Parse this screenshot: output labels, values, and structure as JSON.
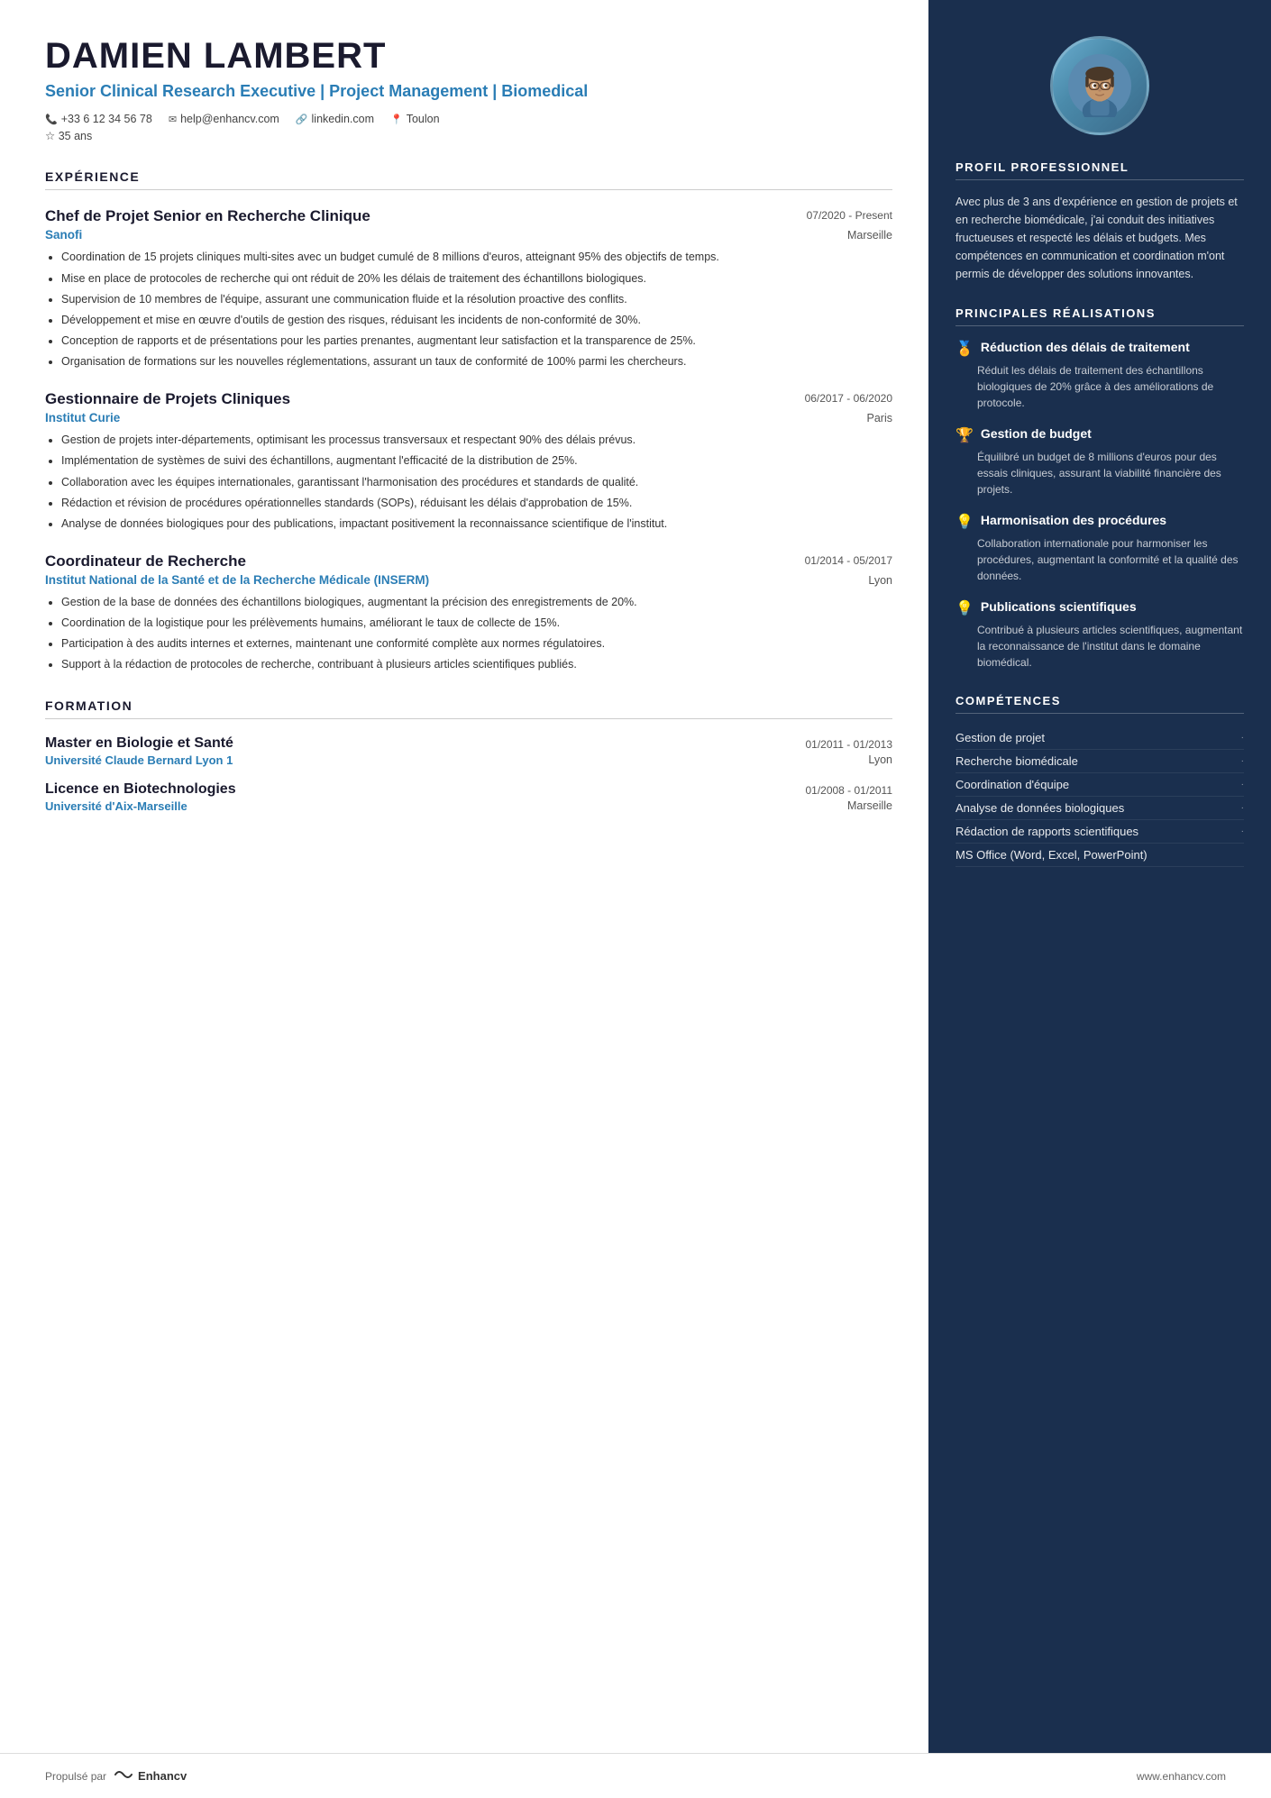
{
  "header": {
    "name": "DAMIEN LAMBERT",
    "title": "Senior Clinical Research Executive | Project Management | Biomedical",
    "phone": "+33 6 12 34 56 78",
    "email": "help@enhancv.com",
    "linkedin": "linkedin.com",
    "city": "Toulon",
    "age": "35 ans"
  },
  "sections": {
    "experience_title": "EXPÉRIENCE",
    "formation_title": "FORMATION"
  },
  "experiences": [
    {
      "job_title": "Chef de Projet Senior en Recherche Clinique",
      "dates": "07/2020 - Present",
      "company": "Sanofi",
      "location": "Marseille",
      "bullets": [
        "Coordination de 15 projets cliniques multi-sites avec un budget cumulé de 8 millions d'euros, atteignant 95% des objectifs de temps.",
        "Mise en place de protocoles de recherche qui ont réduit de 20% les délais de traitement des échantillons biologiques.",
        "Supervision de 10 membres de l'équipe, assurant une communication fluide et la résolution proactive des conflits.",
        "Développement et mise en œuvre d'outils de gestion des risques, réduisant les incidents de non-conformité de 30%.",
        "Conception de rapports et de présentations pour les parties prenantes, augmentant leur satisfaction et la transparence de 25%.",
        "Organisation de formations sur les nouvelles réglementations, assurant un taux de conformité de 100% parmi les chercheurs."
      ]
    },
    {
      "job_title": "Gestionnaire de Projets Cliniques",
      "dates": "06/2017 - 06/2020",
      "company": "Institut Curie",
      "location": "Paris",
      "bullets": [
        "Gestion de projets inter-départements, optimisant les processus transversaux et respectant 90% des délais prévus.",
        "Implémentation de systèmes de suivi des échantillons, augmentant l'efficacité de la distribution de 25%.",
        "Collaboration avec les équipes internationales, garantissant l'harmonisation des procédures et standards de qualité.",
        "Rédaction et révision de procédures opérationnelles standards (SOPs), réduisant les délais d'approbation de 15%.",
        "Analyse de données biologiques pour des publications, impactant positivement la reconnaissance scientifique de l'institut."
      ]
    },
    {
      "job_title": "Coordinateur de Recherche",
      "dates": "01/2014 - 05/2017",
      "company": "Institut National de la Santé et de la Recherche Médicale (INSERM)",
      "location": "Lyon",
      "bullets": [
        "Gestion de la base de données des échantillons biologiques, augmentant la précision des enregistrements de 20%.",
        "Coordination de la logistique pour les prélèvements humains, améliorant le taux de collecte de 15%.",
        "Participation à des audits internes et externes, maintenant une conformité complète aux normes régulatoires.",
        "Support à la rédaction de protocoles de recherche, contribuant à plusieurs articles scientifiques publiés."
      ]
    }
  ],
  "formations": [
    {
      "degree": "Master en Biologie et Santé",
      "dates": "01/2011 - 01/2013",
      "school": "Université Claude Bernard Lyon 1",
      "city": "Lyon"
    },
    {
      "degree": "Licence en Biotechnologies",
      "dates": "01/2008 - 01/2011",
      "school": "Université d'Aix-Marseille",
      "city": "Marseille"
    }
  ],
  "right": {
    "profil_title": "PROFIL PROFESSIONNEL",
    "profil_text": "Avec plus de 3 ans d'expérience en gestion de projets et en recherche biomédicale, j'ai conduit des initiatives fructueuses et respecté les délais et budgets. Mes compétences en communication et coordination m'ont permis de développer des solutions innovantes.",
    "realisations_title": "PRINCIPALES RÉALISATIONS",
    "achievements": [
      {
        "icon": "🏅",
        "title": "Réduction des délais de traitement",
        "desc": "Réduit les délais de traitement des échantillons biologiques de 20% grâce à des améliorations de protocole."
      },
      {
        "icon": "🏆",
        "title": "Gestion de budget",
        "desc": "Équilibré un budget de 8 millions d'euros pour des essais cliniques, assurant la viabilité financière des projets."
      },
      {
        "icon": "💡",
        "title": "Harmonisation des procédures",
        "desc": "Collaboration internationale pour harmoniser les procédures, augmentant la conformité et la qualité des données."
      },
      {
        "icon": "💡",
        "title": "Publications scientifiques",
        "desc": "Contribué à plusieurs articles scientifiques, augmentant la reconnaissance de l'institut dans le domaine biomédical."
      }
    ],
    "competences_title": "COMPÉTENCES",
    "skills": [
      "Gestion de projet",
      "Recherche biomédicale",
      "Coordination d'équipe",
      "Analyse de données biologiques",
      "Rédaction de rapports scientifiques",
      "MS Office (Word, Excel, PowerPoint)"
    ]
  },
  "footer": {
    "powered_by": "Propulsé par",
    "brand": "Enhancv",
    "website": "www.enhancv.com"
  }
}
